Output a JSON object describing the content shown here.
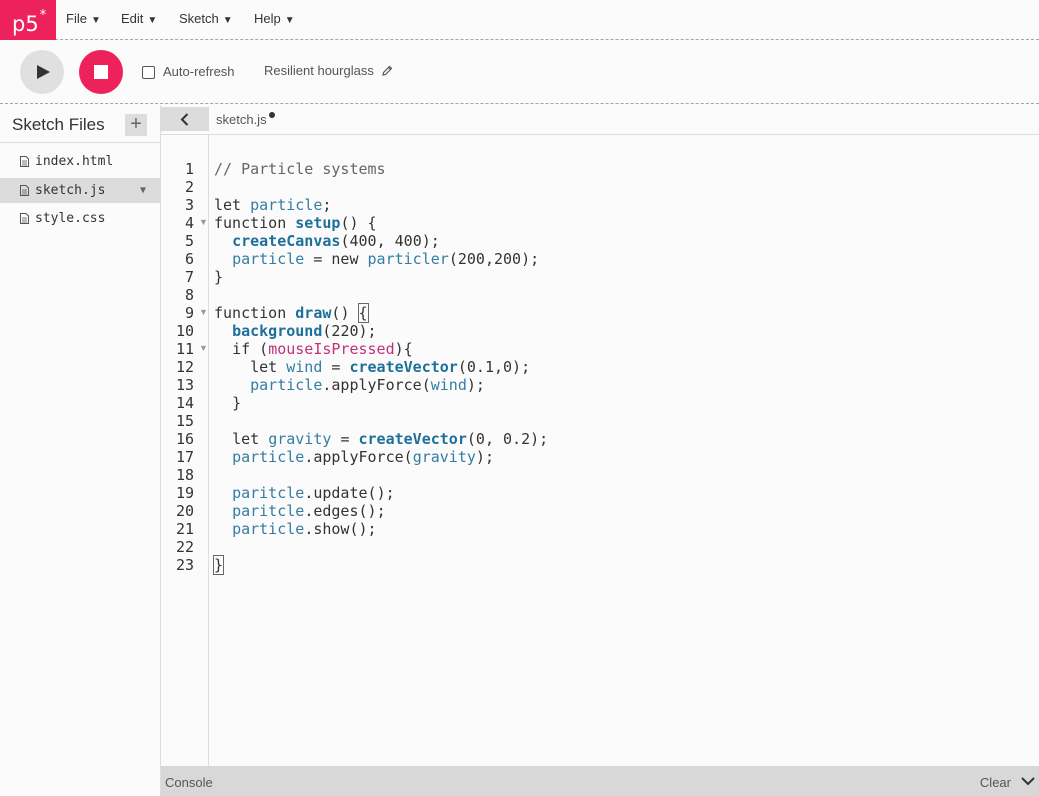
{
  "nav": {
    "logo": "p5",
    "logo_sup": "*",
    "menus": [
      {
        "label": "File"
      },
      {
        "label": "Edit"
      },
      {
        "label": "Sketch"
      },
      {
        "label": "Help"
      }
    ]
  },
  "toolbar": {
    "auto_refresh_label": "Auto-refresh",
    "auto_refresh_checked": false,
    "sketch_name": "Resilient hourglass"
  },
  "sidebar": {
    "title": "Sketch Files",
    "add_label": "+",
    "files": [
      {
        "name": "index.html",
        "selected": false
      },
      {
        "name": "sketch.js",
        "selected": true
      },
      {
        "name": "style.css",
        "selected": false
      }
    ]
  },
  "editor": {
    "active_tab": "sketch.js",
    "unsaved": true,
    "lines": [
      "// Particle systems",
      "",
      "let particle;",
      "function setup() {",
      "  createCanvas(400, 400);",
      "  particle = new particler(200,200);",
      "}",
      "",
      "function draw() {",
      "  background(220);",
      "  if (mouseIsPressed){",
      "    let wind = createVector(0.1,0);",
      "    particle.applyForce(wind);",
      "  }",
      "",
      "  let gravity = createVector(0, 0.2);",
      "  particle.applyForce(gravity);",
      "",
      "  paritcle.update();",
      "  paritcle.edges();",
      "  particle.show();",
      "",
      "}"
    ],
    "fold_lines": [
      4,
      9,
      11
    ]
  },
  "console": {
    "label": "Console",
    "clear_label": "Clear"
  },
  "colors": {
    "brand": "#ed225d",
    "variable": "#347da3",
    "function": "#1e6f9a",
    "builtin_var": "#c0317a"
  }
}
